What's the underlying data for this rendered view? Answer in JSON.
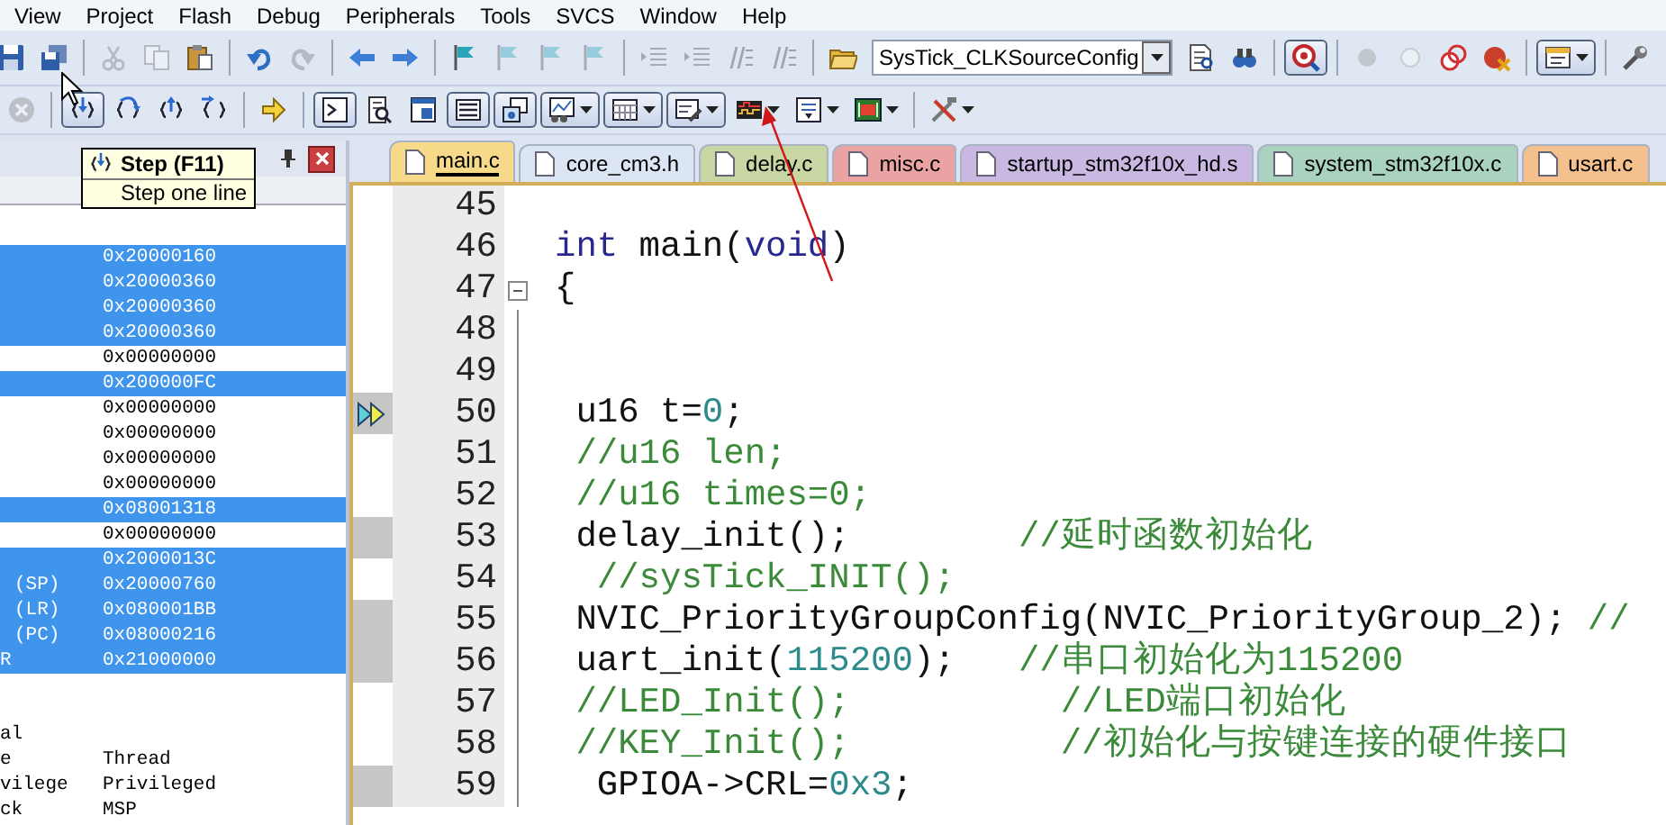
{
  "menu": [
    "View",
    "Project",
    "Flash",
    "Debug",
    "Peripherals",
    "Tools",
    "SVCS",
    "Window",
    "Help"
  ],
  "toolbar_1": [
    {
      "kind": "save",
      "pressed": false,
      "disabled": false,
      "dropdown": false
    },
    {
      "kind": "save-all",
      "pressed": false,
      "disabled": false,
      "dropdown": false
    },
    {
      "kind": "separator"
    },
    {
      "kind": "cut",
      "pressed": false,
      "disabled": true,
      "dropdown": false
    },
    {
      "kind": "copy",
      "pressed": false,
      "disabled": true,
      "dropdown": false
    },
    {
      "kind": "paste",
      "pressed": false,
      "disabled": false,
      "dropdown": false
    },
    {
      "kind": "separator"
    },
    {
      "kind": "undo",
      "pressed": false,
      "disabled": false,
      "dropdown": false
    },
    {
      "kind": "redo",
      "pressed": false,
      "disabled": true,
      "dropdown": false
    },
    {
      "kind": "separator"
    },
    {
      "kind": "back",
      "pressed": false,
      "disabled": false,
      "dropdown": false
    },
    {
      "kind": "forward",
      "pressed": false,
      "disabled": false,
      "dropdown": false
    },
    {
      "kind": "separator"
    },
    {
      "kind": "bookmark",
      "pressed": false,
      "disabled": false,
      "dropdown": false
    },
    {
      "kind": "bookmark",
      "pressed": false,
      "disabled": true,
      "dropdown": false
    },
    {
      "kind": "bookmark",
      "pressed": false,
      "disabled": true,
      "dropdown": false
    },
    {
      "kind": "bookmark",
      "pressed": false,
      "disabled": true,
      "dropdown": false
    },
    {
      "kind": "separator"
    },
    {
      "kind": "indent",
      "pressed": false,
      "disabled": true,
      "dropdown": false
    },
    {
      "kind": "indent",
      "pressed": false,
      "disabled": true,
      "dropdown": false
    },
    {
      "kind": "comment",
      "pressed": false,
      "disabled": true,
      "dropdown": false
    },
    {
      "kind": "comment",
      "pressed": false,
      "disabled": true,
      "dropdown": false
    },
    {
      "kind": "separator"
    },
    {
      "kind": "open",
      "pressed": false,
      "disabled": false,
      "dropdown": false
    },
    {
      "kind": "combo",
      "value": "SysTick_CLKSourceConfig"
    },
    {
      "kind": "find-doc",
      "pressed": false,
      "disabled": false,
      "dropdown": false
    },
    {
      "kind": "binoculars",
      "pressed": false,
      "disabled": false,
      "dropdown": false
    },
    {
      "kind": "separator"
    },
    {
      "kind": "debug",
      "pressed": true,
      "disabled": false,
      "dropdown": false
    },
    {
      "kind": "separator"
    },
    {
      "kind": "breakpoint",
      "pressed": false,
      "disabled": true,
      "dropdown": false
    },
    {
      "kind": "breakpoint-off",
      "pressed": false,
      "disabled": true,
      "dropdown": false
    },
    {
      "kind": "breakpoints-disable",
      "pressed": false,
      "disabled": false,
      "dropdown": false
    },
    {
      "kind": "breakpoints-kill",
      "pressed": false,
      "disabled": false,
      "dropdown": false
    },
    {
      "kind": "separator"
    },
    {
      "kind": "window",
      "pressed": true,
      "disabled": false,
      "dropdown": true
    },
    {
      "kind": "separator"
    },
    {
      "kind": "wrench",
      "pressed": false,
      "disabled": false,
      "dropdown": false
    }
  ],
  "toolbar_2": [
    {
      "kind": "reset",
      "pressed": false,
      "disabled": true,
      "dropdown": false
    },
    {
      "kind": "separator"
    },
    {
      "kind": "step",
      "pressed": true,
      "disabled": false,
      "dropdown": false
    },
    {
      "kind": "step-over",
      "pressed": false,
      "disabled": false,
      "dropdown": false
    },
    {
      "kind": "step-out",
      "pressed": false,
      "disabled": false,
      "dropdown": false
    },
    {
      "kind": "run-to-cursor",
      "pressed": false,
      "disabled": false,
      "dropdown": false
    },
    {
      "kind": "separator"
    },
    {
      "kind": "show-next",
      "pressed": false,
      "disabled": false,
      "dropdown": false
    },
    {
      "kind": "separator"
    },
    {
      "kind": "command",
      "pressed": true,
      "disabled": false,
      "dropdown": false
    },
    {
      "kind": "disassembly",
      "pressed": false,
      "disabled": false,
      "dropdown": false
    },
    {
      "kind": "symbols",
      "pressed": false,
      "disabled": false,
      "dropdown": false
    },
    {
      "kind": "registers",
      "pressed": true,
      "disabled": false,
      "dropdown": false
    },
    {
      "kind": "call-stack",
      "pressed": true,
      "disabled": false,
      "dropdown": false
    },
    {
      "kind": "watch",
      "pressed": true,
      "disabled": false,
      "dropdown": true
    },
    {
      "kind": "memory",
      "pressed": true,
      "disabled": false,
      "dropdown": true
    },
    {
      "kind": "serial",
      "pressed": true,
      "disabled": false,
      "dropdown": true
    },
    {
      "kind": "analysis",
      "pressed": false,
      "disabled": false,
      "dropdown": true
    },
    {
      "kind": "trace",
      "pressed": false,
      "disabled": false,
      "dropdown": true
    },
    {
      "kind": "system-viewer",
      "pressed": false,
      "disabled": false,
      "dropdown": true
    },
    {
      "kind": "separator"
    },
    {
      "kind": "tools",
      "pressed": false,
      "disabled": false,
      "dropdown": true
    }
  ],
  "registers_panel": {
    "rows": [
      {
        "value": "0x20000160",
        "selected": true
      },
      {
        "value": "0x20000360",
        "selected": true
      },
      {
        "value": "0x20000360",
        "selected": true
      },
      {
        "value": "0x20000360",
        "selected": true
      },
      {
        "value": "0x00000000",
        "selected": false
      },
      {
        "value": "0x200000FC",
        "selected": true
      },
      {
        "value": "0x00000000",
        "selected": false
      },
      {
        "value": "0x00000000",
        "selected": false
      },
      {
        "value": "0x00000000",
        "selected": false
      },
      {
        "value": "0x00000000",
        "selected": false
      },
      {
        "value": "0x08001318",
        "selected": true
      },
      {
        "value": "0x00000000",
        "selected": false
      },
      {
        "value": "0x2000013C",
        "selected": true
      },
      {
        "label": "(SP)",
        "value": "0x20000760",
        "selected": true
      },
      {
        "label": "(LR)",
        "value": "0x080001BB",
        "selected": true
      },
      {
        "label": "(PC)",
        "value": "0x08000216",
        "selected": true
      },
      {
        "label": "R",
        "value": "0x21000000",
        "selected": true
      }
    ],
    "mode_rows": [
      {
        "label": "al",
        "selected": false
      },
      {
        "label": "e",
        "value": "Thread",
        "selected": false
      },
      {
        "label": "vilege",
        "value": "Privileged",
        "selected": false
      },
      {
        "label": "ck",
        "value": "MSP",
        "selected": false
      }
    ]
  },
  "tooltip": {
    "title": "Step (F11)",
    "text": "Step one line"
  },
  "editor": {
    "tabs": [
      {
        "label": "main.c",
        "color": "#f7d98a",
        "selected": true
      },
      {
        "label": "core_cm3.h",
        "color": "#dbe5f4",
        "selected": false
      },
      {
        "label": "delay.c",
        "color": "#c7d6a2",
        "selected": false
      },
      {
        "label": "misc.c",
        "color": "#e9a3a3",
        "selected": false
      },
      {
        "label": "startup_stm32f10x_hd.s",
        "color": "#c8b8e2",
        "selected": false
      },
      {
        "label": "system_stm32f10x.c",
        "color": "#a9d2c0",
        "selected": false
      },
      {
        "label": "usart.c",
        "color": "#f4c08e",
        "selected": false
      }
    ],
    "lines": [
      {
        "number": "45",
        "current": false,
        "executable": false,
        "fold_start": false,
        "in_fold": false
      },
      {
        "number": "46",
        "current": false,
        "executable": false,
        "fold_start": false,
        "in_fold": false,
        "segments": [
          {
            "kind": "keyword",
            "text": "int"
          },
          {
            "kind": "plain",
            "text": " main("
          },
          {
            "kind": "keyword",
            "text": "void"
          },
          {
            "kind": "plain",
            "text": ")"
          }
        ]
      },
      {
        "number": "47",
        "current": false,
        "executable": false,
        "fold_start": true,
        "in_fold": false,
        "segments": [
          {
            "kind": "plain",
            "text": "{"
          }
        ]
      },
      {
        "number": "48",
        "current": false,
        "executable": false,
        "fold_start": false,
        "in_fold": true
      },
      {
        "number": "49",
        "current": false,
        "executable": false,
        "fold_start": false,
        "in_fold": true
      },
      {
        "number": "50",
        "current": true,
        "executable": false,
        "fold_start": false,
        "in_fold": true,
        "segments": [
          {
            "kind": "plain",
            "text": " u16 t="
          },
          {
            "kind": "number",
            "text": "0"
          },
          {
            "kind": "plain",
            "text": ";"
          }
        ]
      },
      {
        "number": "51",
        "current": false,
        "executable": false,
        "fold_start": false,
        "in_fold": true,
        "segments": [
          {
            "kind": "comment",
            "text": " //u16 len;"
          }
        ]
      },
      {
        "number": "52",
        "current": false,
        "executable": false,
        "fold_start": false,
        "in_fold": true,
        "segments": [
          {
            "kind": "comment",
            "text": " //u16 times=0;"
          }
        ]
      },
      {
        "number": "53",
        "current": false,
        "executable": true,
        "fold_start": false,
        "in_fold": true,
        "segments": [
          {
            "kind": "plain",
            "text": " delay_init();"
          },
          {
            "kind": "comment",
            "text": "        //延时函数初始化"
          }
        ]
      },
      {
        "number": "54",
        "current": false,
        "executable": false,
        "fold_start": false,
        "in_fold": true,
        "segments": [
          {
            "kind": "comment",
            "text": "  //sysTick_INIT();"
          }
        ]
      },
      {
        "number": "55",
        "current": false,
        "executable": true,
        "fold_start": false,
        "in_fold": true,
        "segments": [
          {
            "kind": "plain",
            "text": " NVIC_PriorityGroupConfig(NVIC_PriorityGroup_2);"
          },
          {
            "kind": "comment",
            "text": " //"
          }
        ]
      },
      {
        "number": "56",
        "current": false,
        "executable": true,
        "fold_start": false,
        "in_fold": true,
        "segments": [
          {
            "kind": "plain",
            "text": " uart_init("
          },
          {
            "kind": "number",
            "text": "115200"
          },
          {
            "kind": "plain",
            "text": ");"
          },
          {
            "kind": "comment",
            "text": "   //串口初始化为115200"
          }
        ]
      },
      {
        "number": "57",
        "current": false,
        "executable": false,
        "fold_start": false,
        "in_fold": true,
        "segments": [
          {
            "kind": "comment",
            "text": " //LED_Init();"
          },
          {
            "kind": "comment",
            "text": "          //LED端口初始化"
          }
        ]
      },
      {
        "number": "58",
        "current": false,
        "executable": false,
        "fold_start": false,
        "in_fold": true,
        "segments": [
          {
            "kind": "comment",
            "text": " //KEY_Init();"
          },
          {
            "kind": "comment",
            "text": "          //初始化与按键连接的硬件接口"
          }
        ]
      },
      {
        "number": "59",
        "current": false,
        "executable": true,
        "fold_start": false,
        "in_fold": true,
        "segments": [
          {
            "kind": "plain",
            "text": "  GPIOA->CRL="
          },
          {
            "kind": "number",
            "text": "0x3"
          },
          {
            "kind": "plain",
            "text": ";"
          }
        ]
      }
    ]
  },
  "annotation": {
    "kind": "arrow"
  },
  "cursor": {
    "kind": "arrow"
  }
}
